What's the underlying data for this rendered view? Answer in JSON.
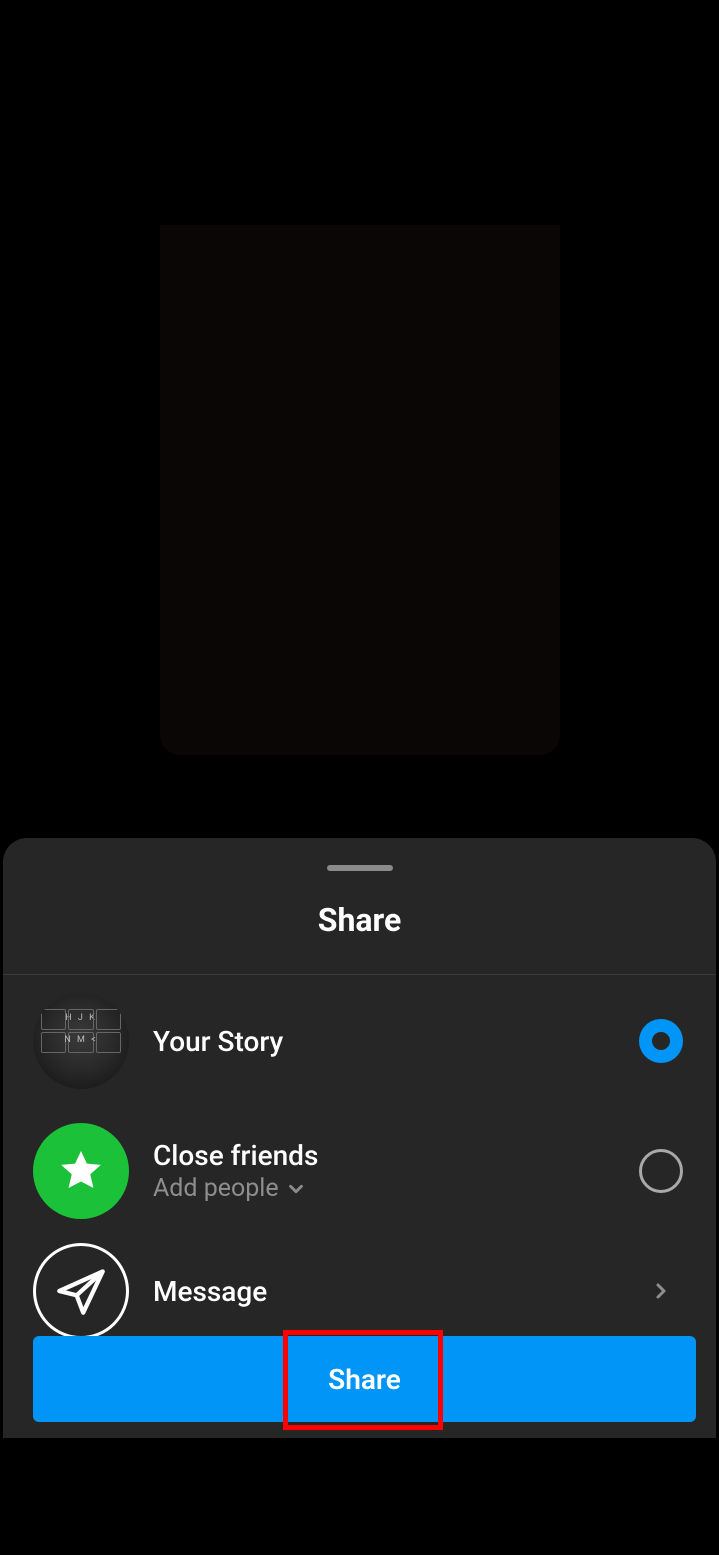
{
  "sheet": {
    "title": "Share",
    "options": {
      "your_story": {
        "label": "Your Story",
        "selected": true
      },
      "close_friends": {
        "label": "Close friends",
        "sublabel": "Add people",
        "selected": false
      },
      "message": {
        "label": "Message"
      }
    },
    "share_button": "Share"
  },
  "colors": {
    "accent": "#0095f6",
    "green": "#1bc138",
    "sheet_bg": "#262626",
    "highlight": "#ff0000"
  }
}
